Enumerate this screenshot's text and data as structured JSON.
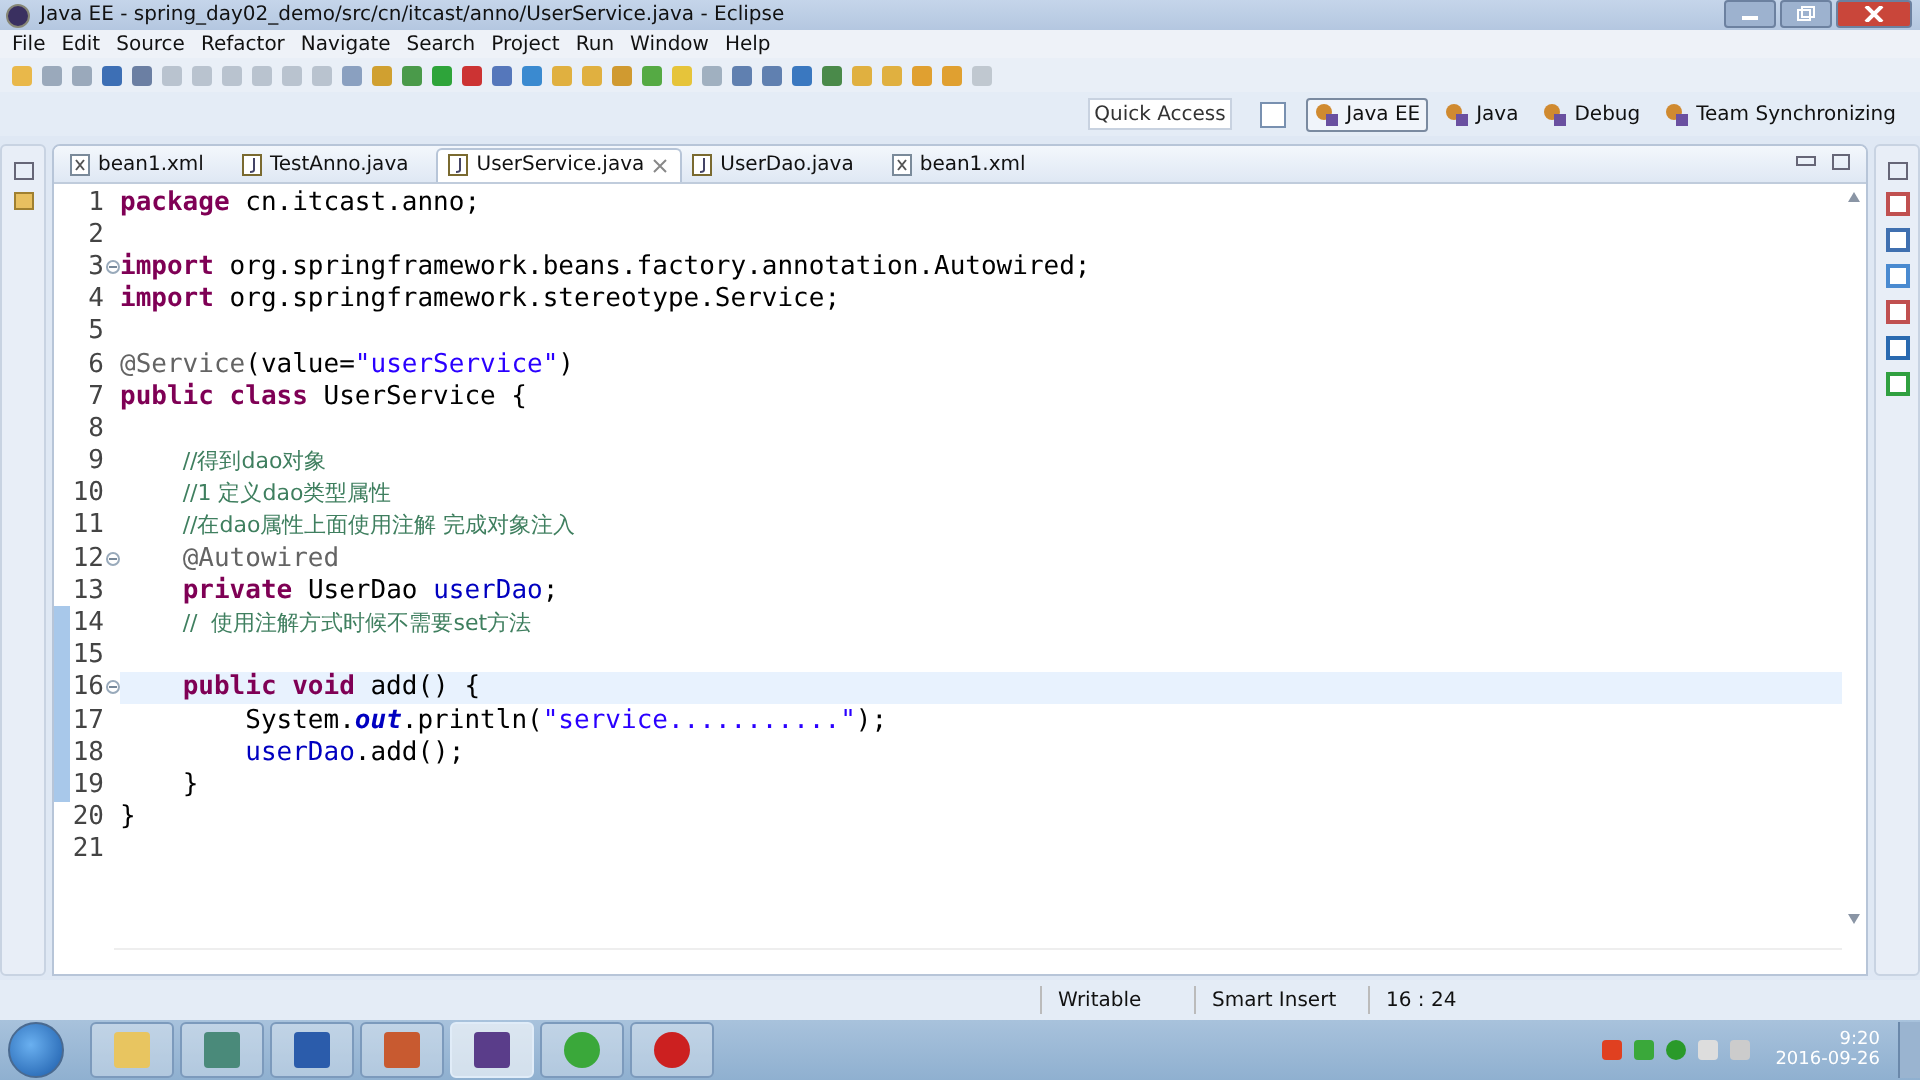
{
  "window": {
    "title": "Java EE - spring_day02_demo/src/cn/itcast/anno/UserService.java - Eclipse"
  },
  "menu": [
    "File",
    "Edit",
    "Source",
    "Refactor",
    "Navigate",
    "Search",
    "Project",
    "Run",
    "Window",
    "Help"
  ],
  "quick_access": {
    "placeholder": "Quick Access"
  },
  "perspectives": [
    {
      "label": "Java EE",
      "selected": true
    },
    {
      "label": "Java",
      "selected": false
    },
    {
      "label": "Debug",
      "selected": false
    },
    {
      "label": "Team Synchronizing",
      "selected": false
    }
  ],
  "tabs": [
    {
      "label": "bean1.xml",
      "kind": "xml",
      "selected": false
    },
    {
      "label": "TestAnno.java",
      "kind": "java",
      "selected": false
    },
    {
      "label": "UserService.java",
      "kind": "java",
      "selected": true
    },
    {
      "label": "UserDao.java",
      "kind": "java",
      "selected": false
    },
    {
      "label": "bean1.xml",
      "kind": "xml",
      "selected": false
    }
  ],
  "editor": {
    "lines": [
      {
        "number": "1",
        "fold": false,
        "changed": false,
        "current": false,
        "tokens": [
          {
            "kind": "keyword",
            "text": "package"
          },
          {
            "kind": "plain",
            "text": " cn.itcast.anno;"
          }
        ]
      },
      {
        "number": "2",
        "fold": false,
        "changed": false,
        "current": false
      },
      {
        "number": "3",
        "fold": true,
        "changed": false,
        "current": false,
        "tokens": [
          {
            "kind": "keyword",
            "text": "import"
          },
          {
            "kind": "plain",
            "text": " org.springframework.beans.factory.annotation.Autowired;"
          }
        ]
      },
      {
        "number": "4",
        "fold": false,
        "changed": false,
        "current": false,
        "tokens": [
          {
            "kind": "keyword",
            "text": "import"
          },
          {
            "kind": "plain",
            "text": " org.springframework.stereotype.Service;"
          }
        ]
      },
      {
        "number": "5",
        "fold": false,
        "changed": false,
        "current": false
      },
      {
        "number": "6",
        "fold": false,
        "changed": false,
        "current": false,
        "tokens": [
          {
            "kind": "annotation",
            "text": "@Service"
          },
          {
            "kind": "plain",
            "text": "(value="
          },
          {
            "kind": "string",
            "text": "\"userService\""
          },
          {
            "kind": "plain",
            "text": ")"
          }
        ]
      },
      {
        "number": "7",
        "fold": false,
        "changed": false,
        "current": false,
        "tokens": [
          {
            "kind": "keyword",
            "text": "public class"
          },
          {
            "kind": "plain",
            "text": " UserService {"
          }
        ]
      },
      {
        "number": "8",
        "fold": false,
        "changed": false,
        "current": false
      },
      {
        "number": "9",
        "fold": false,
        "changed": false,
        "current": false,
        "tokens": [
          {
            "kind": "comment",
            "text": "    //得到dao对象"
          }
        ]
      },
      {
        "number": "10",
        "fold": false,
        "changed": false,
        "current": false,
        "tokens": [
          {
            "kind": "comment",
            "text": "    //1 定义dao类型属性"
          }
        ]
      },
      {
        "number": "11",
        "fold": false,
        "changed": false,
        "current": false,
        "tokens": [
          {
            "kind": "comment",
            "text": "    //在dao属性上面使用注解 完成对象注入"
          }
        ]
      },
      {
        "number": "12",
        "fold": true,
        "changed": false,
        "current": false,
        "tokens": [
          {
            "kind": "annotation",
            "text": "    @Autowired"
          }
        ]
      },
      {
        "number": "13",
        "fold": false,
        "changed": false,
        "current": false,
        "tokens": [
          {
            "kind": "keyword",
            "text": "    private"
          },
          {
            "kind": "plain",
            "text": " UserDao "
          },
          {
            "kind": "field",
            "text": "userDao"
          },
          {
            "kind": "plain",
            "text": ";"
          }
        ]
      },
      {
        "number": "14",
        "fold": false,
        "changed": true,
        "current": false,
        "tokens": [
          {
            "kind": "comment",
            "text": "    //  使用注解方式时候不需要set方法"
          }
        ]
      },
      {
        "number": "15",
        "fold": false,
        "changed": true,
        "current": false
      },
      {
        "number": "16",
        "fold": true,
        "changed": true,
        "current": true,
        "tokens": [
          {
            "kind": "keyword",
            "text": "    public void"
          },
          {
            "kind": "plain",
            "text": " add() {"
          }
        ]
      },
      {
        "number": "17",
        "fold": false,
        "changed": true,
        "current": false,
        "tokens": [
          {
            "kind": "plain",
            "text": "        System."
          },
          {
            "kind": "static",
            "text": "out"
          },
          {
            "kind": "plain",
            "text": ".println("
          },
          {
            "kind": "string",
            "text": "\"service...........\""
          },
          {
            "kind": "plain",
            "text": ");"
          }
        ]
      },
      {
        "number": "18",
        "fold": false,
        "changed": true,
        "current": false,
        "tokens": [
          {
            "kind": "field",
            "text": "        userDao"
          },
          {
            "kind": "plain",
            "text": ".add();"
          }
        ]
      },
      {
        "number": "19",
        "fold": false,
        "changed": true,
        "current": false,
        "tokens": [
          {
            "kind": "plain",
            "text": "    }"
          }
        ]
      },
      {
        "number": "20",
        "fold": false,
        "changed": false,
        "current": false,
        "tokens": [
          {
            "kind": "plain",
            "text": "}"
          }
        ]
      },
      {
        "number": "21",
        "fold": false,
        "changed": false,
        "current": false
      }
    ]
  },
  "status_bar": [
    "Writable",
    "Smart Insert",
    "16 : 24"
  ],
  "taskbar": {
    "apps": [
      {
        "kind": "folder",
        "selected": false
      },
      {
        "kind": "window",
        "selected": false
      },
      {
        "kind": "word",
        "selected": false
      },
      {
        "kind": "slides",
        "selected": false
      },
      {
        "kind": "gear",
        "selected": true
      },
      {
        "kind": "browser",
        "selected": false
      },
      {
        "kind": "hexagon",
        "selected": false
      }
    ],
    "time": "9:20",
    "date": "2016-09-26"
  }
}
